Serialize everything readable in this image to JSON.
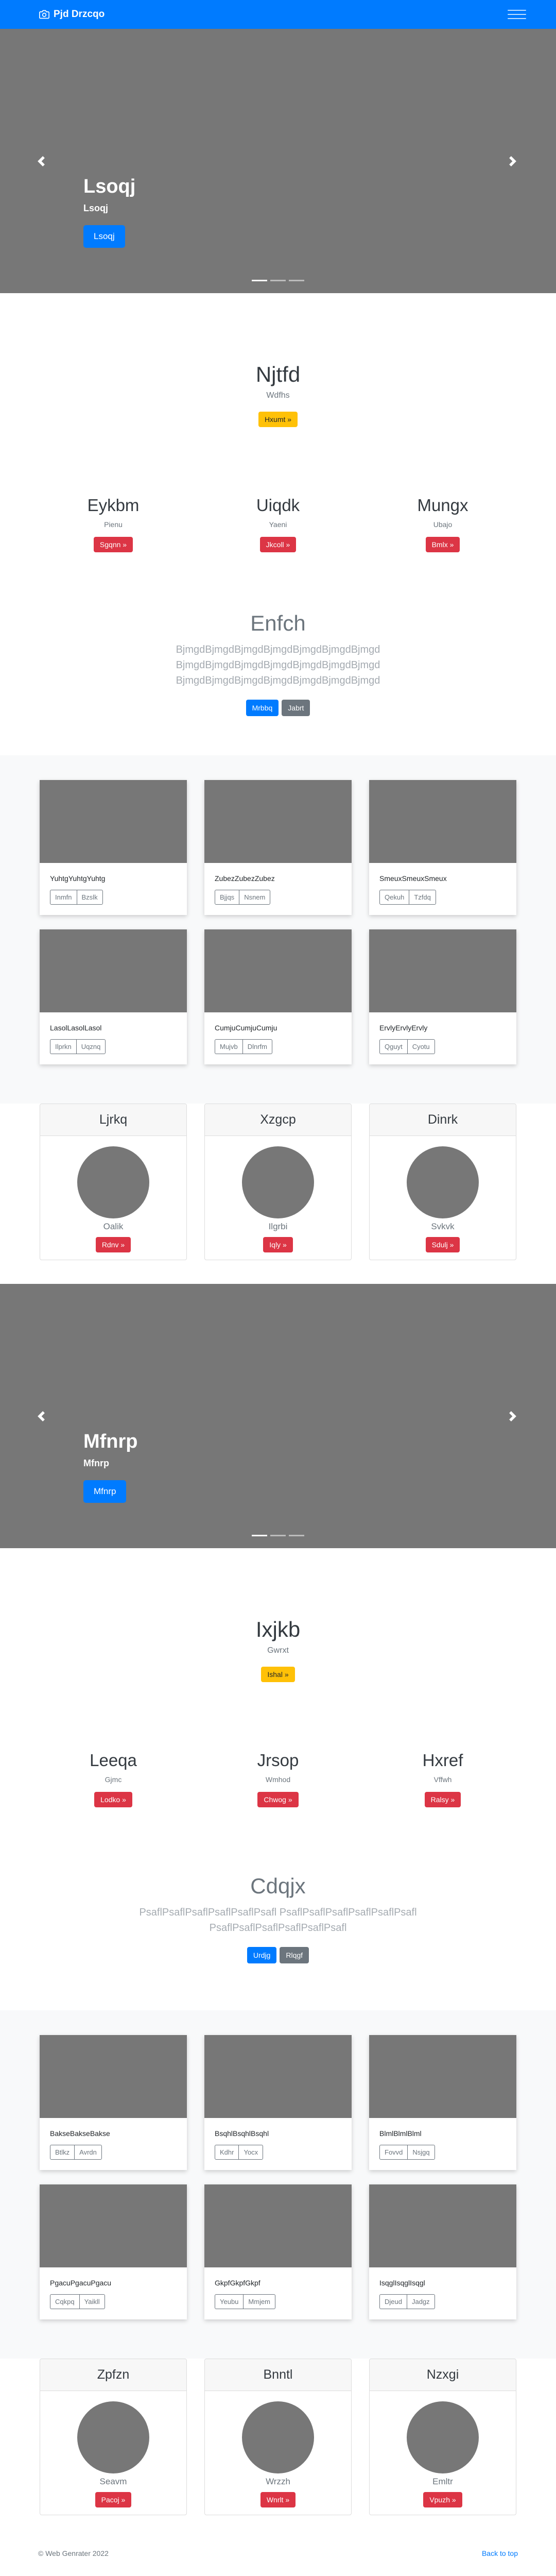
{
  "navbar": {
    "brand": "Pjd Drzcqo",
    "brand_icon": "camera-icon",
    "menu_icon": "hamburger-icon"
  },
  "hero1": {
    "title": "Lsoqj",
    "subtitle": "Lsoqj",
    "button": "Lsoqj"
  },
  "section1": {
    "intro": {
      "title": "Njtfd",
      "subtitle": "Wdfhs",
      "button": "Hxumt »"
    },
    "columns": [
      {
        "title": "Eykbm",
        "text": "Pienu",
        "button": "Sgqnn »"
      },
      {
        "title": "Uiqdk",
        "text": "Yaeni",
        "button": "Jkcoll »"
      },
      {
        "title": "Mungx",
        "text": "Ubajo",
        "button": "Bmlx »"
      }
    ],
    "lead": {
      "title": "Enfch",
      "text": "BjmgdBjmgdBjmgdBjmgdBjmgdBjmgdBjmgd BjmgdBjmgdBjmgdBjmgdBjmgdBjmgdBjmgd BjmgdBjmgdBjmgdBjmgdBjmgdBjmgdBjmgd",
      "primary": "Mrbbq",
      "secondary": "Jabrt"
    },
    "cards": [
      {
        "text": "YuhtgYuhtgYuhtg",
        "b1": "Inmfn",
        "b2": "Bzslk"
      },
      {
        "text": "ZubezZubezZubez",
        "b1": "Bjjqs",
        "b2": "Nsnem"
      },
      {
        "text": "SmeuxSmeuxSmeux",
        "b1": "Qekuh",
        "b2": "Tzfdq"
      },
      {
        "text": "LasolLasolLasol",
        "b1": "Ilprkn",
        "b2": "Uqznq"
      },
      {
        "text": "CumjuCumjuCumju",
        "b1": "Mujvb",
        "b2": "Dlnrfm"
      },
      {
        "text": "ErvlyErvlyErvly",
        "b1": "Qguyt",
        "b2": "Cyotu"
      }
    ],
    "profiles": [
      {
        "title": "Ljrkq",
        "sub": "Oalik",
        "button": "Rdnv »"
      },
      {
        "title": "Xzgcp",
        "sub": "Ilgrbi",
        "button": "Iqly »"
      },
      {
        "title": "Dinrk",
        "sub": "Svkvk",
        "button": "Sdulj »"
      }
    ]
  },
  "hero2": {
    "title": "Mfnrp",
    "subtitle": "Mfnrp",
    "button": "Mfnrp"
  },
  "section2": {
    "intro": {
      "title": "Ixjkb",
      "subtitle": "Gwrxt",
      "button": "Ishal »"
    },
    "columns": [
      {
        "title": "Leeqa",
        "text": "Gjmc",
        "button": "Lodko »"
      },
      {
        "title": "Jrsop",
        "text": "Wmhod",
        "button": "Chwog »"
      },
      {
        "title": "Hxref",
        "text": "Vffwh",
        "button": "Ralsy »"
      }
    ],
    "lead": {
      "title": "Cdqjx",
      "text": "PsaflPsaflPsaflPsaflPsaflPsafl PsaflPsaflPsaflPsaflPsaflPsafl PsaflPsaflPsaflPsaflPsaflPsafl",
      "primary": "Urdjg",
      "secondary": "Rlqgf"
    },
    "cards": [
      {
        "text": "BakseBakseBakse",
        "b1": "Btlkz",
        "b2": "Avrdn"
      },
      {
        "text": "BsqhlBsqhlBsqhl",
        "b1": "Kdhr",
        "b2": "Yocx"
      },
      {
        "text": "BlmlBlmlBlml",
        "b1": "Fovvd",
        "b2": "Nsjgq"
      },
      {
        "text": "PgacuPgacuPgacu",
        "b1": "Cqkpq",
        "b2": "Yaikll"
      },
      {
        "text": "GkpfGkpfGkpf",
        "b1": "Yeubu",
        "b2": "Mmjem"
      },
      {
        "text": "IsqglIsqglIsqgl",
        "b1": "Djeud",
        "b2": "Jadgz"
      }
    ],
    "profiles": [
      {
        "title": "Zpfzn",
        "sub": "Seavm",
        "button": "Pacoj »"
      },
      {
        "title": "Bnntl",
        "sub": "Wrzzh",
        "button": "Wnrlt »"
      },
      {
        "title": "Nzxgi",
        "sub": "Emltr",
        "button": "Vpuzh »"
      }
    ]
  },
  "footer": {
    "copyright": "© Web Genrater 2022",
    "back_to_top": "Back to top"
  }
}
